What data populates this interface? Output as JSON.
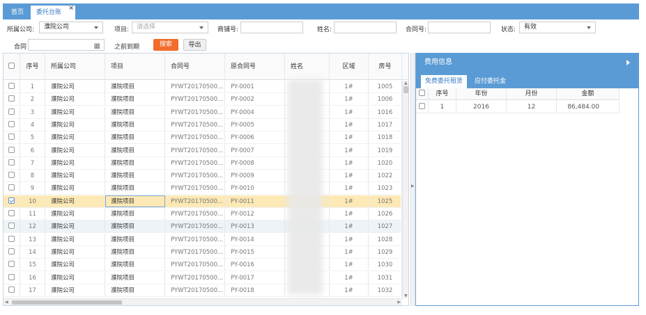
{
  "tabs": {
    "home": "首页",
    "active": "委托台账",
    "close": "×"
  },
  "filters": {
    "company_label": "所属公司:",
    "company_value": "濮院公司",
    "project_label": "项目:",
    "project_placeholder": "请选择",
    "shop_label": "商铺号:",
    "shop_value": "",
    "name_label": "姓名:",
    "name_value": "",
    "contract_label": "合同号:",
    "contract_value": "",
    "status_label": "状态:",
    "status_value": "有效",
    "contract2_label": "合同",
    "contract2_value": "",
    "expire_label": "之前到期",
    "search_button": "搜索",
    "export_button": "导出"
  },
  "grid": {
    "headers": [
      "序号",
      "所属公司",
      "项目",
      "合同号",
      "原合同号",
      "姓名",
      "区域",
      "房号"
    ],
    "rows": [
      [
        "1",
        "濮院公司",
        "濮院项目",
        "PYWT20170500...",
        "PY-0001",
        "",
        "1#",
        "1005"
      ],
      [
        "2",
        "濮院公司",
        "濮院项目",
        "PYWT20170500...",
        "PY-0002",
        "",
        "1#",
        "1006"
      ],
      [
        "3",
        "濮院公司",
        "濮院项目",
        "PYWT20170500...",
        "PY-0004",
        "",
        "1#",
        "1016"
      ],
      [
        "4",
        "濮院公司",
        "濮院项目",
        "PYWT20170500...",
        "PY-0005",
        "",
        "1#",
        "1017"
      ],
      [
        "5",
        "濮院公司",
        "濮院项目",
        "PYWT20170500...",
        "PY-0006",
        "",
        "1#",
        "1018"
      ],
      [
        "6",
        "濮院公司",
        "濮院项目",
        "PYWT20170500...",
        "PY-0007",
        "",
        "1#",
        "1019"
      ],
      [
        "7",
        "濮院公司",
        "濮院项目",
        "PYWT20170500...",
        "PY-0008",
        "",
        "1#",
        "1020"
      ],
      [
        "8",
        "濮院公司",
        "濮院项目",
        "PYWT20170500...",
        "PY-0009",
        "",
        "1#",
        "1022"
      ],
      [
        "9",
        "濮院公司",
        "濮院项目",
        "PYWT20170500...",
        "PY-0010",
        "",
        "1#",
        "1023"
      ],
      [
        "10",
        "濮院公司",
        "濮院项目",
        "PYWT20170500...",
        "PY-0011",
        "",
        "1#",
        "1025"
      ],
      [
        "11",
        "濮院公司",
        "濮院项目",
        "PYWT20170500...",
        "PY-0012",
        "",
        "1#",
        "1026"
      ],
      [
        "12",
        "濮院公司",
        "濮院项目",
        "PYWT20170500...",
        "PY-0013",
        "",
        "1#",
        "1027"
      ],
      [
        "13",
        "濮院公司",
        "濮院项目",
        "PYWT20170500...",
        "PY-0014",
        "",
        "1#",
        "1028"
      ],
      [
        "14",
        "濮院公司",
        "濮院项目",
        "PYWT20170500...",
        "PY-0015",
        "",
        "1#",
        "1029"
      ],
      [
        "15",
        "濮院公司",
        "濮院项目",
        "PYWT20170500...",
        "PY-0016",
        "",
        "1#",
        "1030"
      ],
      [
        "16",
        "濮院公司",
        "濮院项目",
        "PYWT20170500...",
        "PY-0017",
        "",
        "1#",
        "1031"
      ],
      [
        "17",
        "濮院公司",
        "濮院项目",
        "PYWT20170500...",
        "PY-0018",
        "",
        "1#",
        "1032"
      ]
    ],
    "selected_row": 10,
    "alt_row": 12
  },
  "panel": {
    "title": "费用信息",
    "tab_active": "免费委托租赁",
    "tab_other": "应付委托金",
    "headers": [
      "序号",
      "年份",
      "月份",
      "金额"
    ],
    "rows": [
      [
        "1",
        "2016",
        "12",
        "86,484.00"
      ]
    ]
  },
  "colors": {
    "accent": "#5b9bd5",
    "search": "#f26c2b",
    "selected_row": "#fde9b5"
  }
}
